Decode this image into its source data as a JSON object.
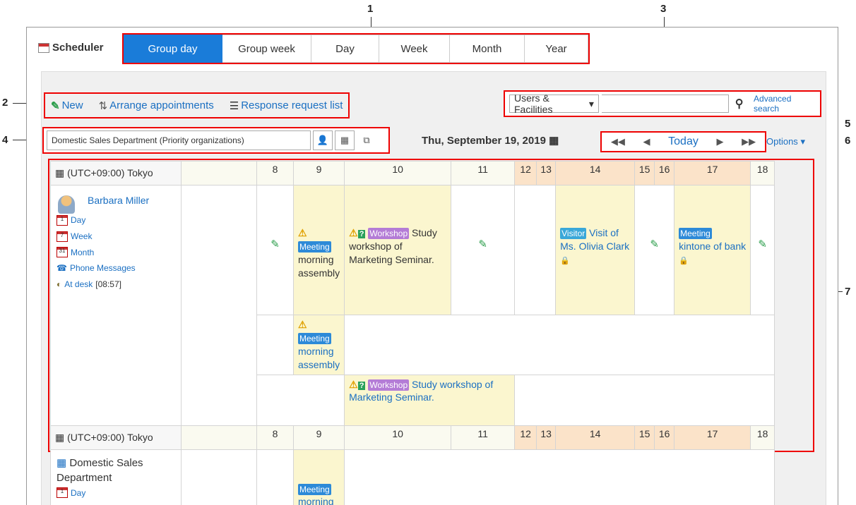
{
  "callouts": [
    "1",
    "2",
    "3",
    "4",
    "5",
    "6",
    "7"
  ],
  "app": {
    "title": "Scheduler"
  },
  "view_tabs": [
    {
      "label": "Group day",
      "active": true
    },
    {
      "label": "Group week",
      "active": false
    },
    {
      "label": "Day",
      "active": false
    },
    {
      "label": "Week",
      "active": false
    },
    {
      "label": "Month",
      "active": false
    },
    {
      "label": "Year",
      "active": false
    }
  ],
  "actions": {
    "new": "New",
    "arrange": "Arrange appointments",
    "response": "Response request list"
  },
  "search": {
    "scope": "Users & Facilities",
    "advanced": "Advanced search"
  },
  "organization": {
    "selected": "Domestic Sales Department (Priority organizations)"
  },
  "date": {
    "label": "Thu, September 19, 2019"
  },
  "nav": {
    "today": "Today",
    "options": "Options"
  },
  "grid": {
    "timezone": "(UTC+09:00) Tokyo",
    "hours": [
      "8",
      "9",
      "10",
      "11",
      "12",
      "13",
      "14",
      "15",
      "16",
      "17",
      "18"
    ]
  },
  "user": {
    "name": "Barbara Miller",
    "links": [
      "Day",
      "Week",
      "Month",
      "Phone Messages"
    ],
    "status": "At desk",
    "status_time": "[08:57]"
  },
  "events": {
    "meeting_morning": {
      "tag": "Meeting",
      "title": "morning assembly"
    },
    "workshop": {
      "tag": "Workshop",
      "title": "Study workshop of Marketing Seminar."
    },
    "visitor": {
      "tag": "Visitor",
      "title": "Visit of Ms. Olivia Clark"
    },
    "kintone": {
      "tag": "Meeting",
      "title": "kintone of bank"
    }
  },
  "org_section": {
    "timezone": "(UTC+09:00) Tokyo",
    "name": "Domestic Sales Department",
    "link": "Day",
    "event_tag": "Meeting",
    "event_title": "morning"
  },
  "colors": {
    "accent": "#1a7cd9",
    "callout": "#e00000",
    "link": "#1a6fc2",
    "event_bg": "#fbf6cf"
  }
}
